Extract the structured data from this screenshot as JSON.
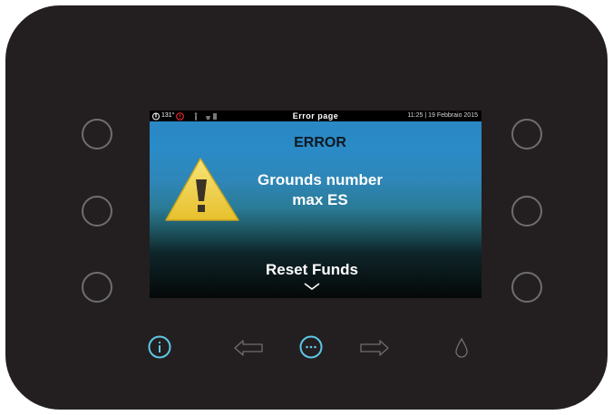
{
  "screen": {
    "status_bar": {
      "temperature": "131°",
      "title": "Error page",
      "datetime": "11:25 | 19 Febbraio 2015"
    },
    "error_title": "ERROR",
    "error_message_line1": "Grounds number",
    "error_message_line2": "max ES",
    "action_label": "Reset Funds"
  },
  "colors": {
    "panel": "#231f20",
    "accent": "#5ec6e6",
    "muted_icon": "#6e6e6e",
    "warning_yellow": "#f2d64a"
  },
  "icons": [
    "thermometer-icon",
    "alert-icon",
    "person-icon",
    "cup-icon",
    "warning-triangle-icon",
    "chevron-down-icon",
    "info-icon",
    "arrow-left-icon",
    "menu-dots-icon",
    "arrow-right-icon",
    "water-drop-icon"
  ]
}
